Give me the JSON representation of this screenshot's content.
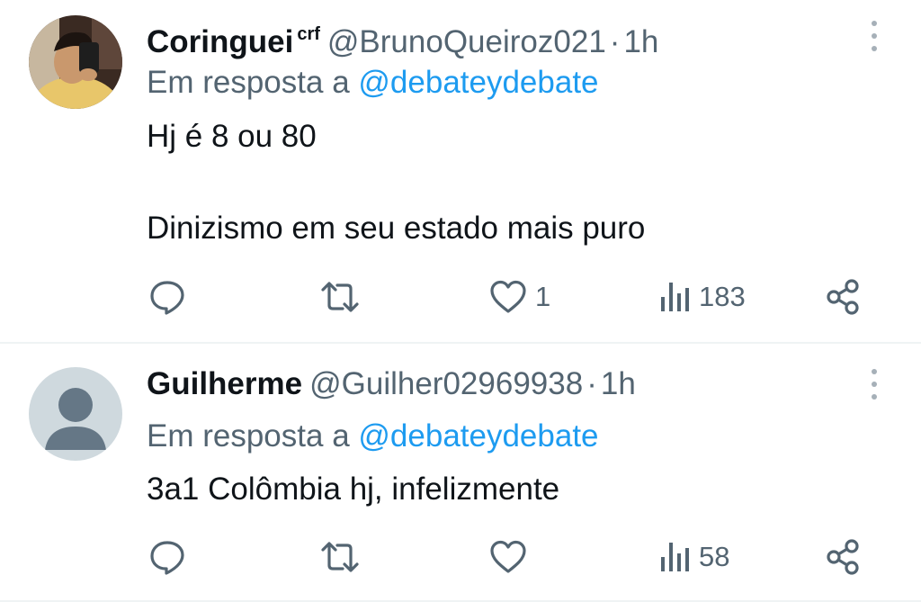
{
  "tweets": [
    {
      "name": "Coringuei",
      "flair": "crf",
      "handle": "@BrunoQueiroz021",
      "separator": "·",
      "time": "1h",
      "reply_prefix": "Em resposta a",
      "reply_to": "@debateydebate",
      "text_lines": [
        "Hj é 8 ou 80",
        "Dinizismo em seu estado mais puro"
      ],
      "likes": "1",
      "views": "183"
    },
    {
      "name": "Guilherme",
      "handle": "@Guilher02969938",
      "separator": "·",
      "time": "1h",
      "reply_prefix": "Em resposta a",
      "reply_to": "@debateydebate",
      "text_lines": [
        "3a1 Colômbia hj, infelizmente"
      ],
      "likes": "",
      "views": "58"
    }
  ],
  "icons": {
    "reply": "reply-icon",
    "retweet": "retweet-icon",
    "like": "heart-icon",
    "views": "views-icon",
    "share": "share-icon",
    "more": "more-icon"
  },
  "colors": {
    "text": "#0f1419",
    "secondary": "#536471",
    "link": "#1d9bf0",
    "divider": "#eff3f4"
  }
}
